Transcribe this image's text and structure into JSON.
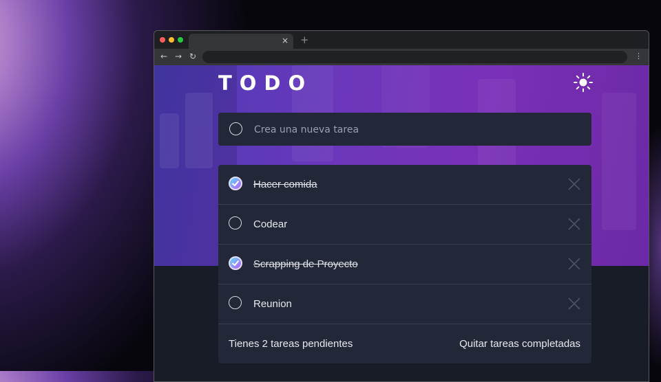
{
  "browser": {
    "tab_close": "×",
    "new_tab": "+",
    "nav_back": "←",
    "nav_forward": "→",
    "nav_reload": "↻",
    "menu": "⋮",
    "icons": [
      "close-icon",
      "plus-icon",
      "arrow-left-icon",
      "arrow-right-icon",
      "reload-icon",
      "kebab-menu-icon"
    ]
  },
  "app": {
    "title": "TODO",
    "theme_icon": "sun-icon",
    "new_todo": {
      "placeholder": "Crea una nueva tarea"
    },
    "todos": [
      {
        "text": "Hacer comida",
        "completed": true
      },
      {
        "text": "Codear",
        "completed": false
      },
      {
        "text": "Scrapping de Proyecto",
        "completed": true
      },
      {
        "text": "Reunion",
        "completed": false
      }
    ],
    "footer": {
      "items_left": "Tienes 2 tareas pendientes",
      "clear_completed": "Quitar tareas completadas"
    }
  },
  "colors": {
    "check_gradient_start": "#57ddff",
    "check_gradient_end": "#c058f3",
    "card_bg": "#222838",
    "page_bg": "#171c26"
  }
}
